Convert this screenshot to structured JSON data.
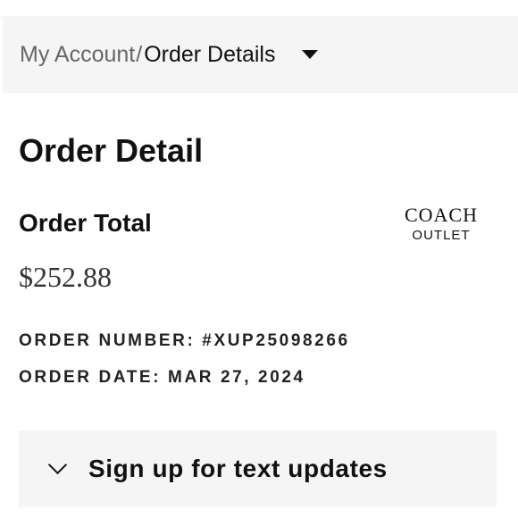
{
  "breadcrumb": {
    "parent_label": "My Account",
    "separator": "/",
    "current_label": "Order Details"
  },
  "page": {
    "title": "Order Detail"
  },
  "order": {
    "total_label": "Order Total",
    "total_amount": "$252.88",
    "number_line": "ORDER NUMBER: #XUP25098266",
    "date_line": "ORDER DATE: MAR 27, 2024"
  },
  "logo": {
    "brand": "COACH",
    "sub": "OUTLET"
  },
  "sms": {
    "label": "Sign up for text updates"
  },
  "colors": {
    "text": "#111111",
    "muted": "#666666",
    "panel_bg": "#f5f5f5",
    "page_bg": "#ffffff"
  }
}
